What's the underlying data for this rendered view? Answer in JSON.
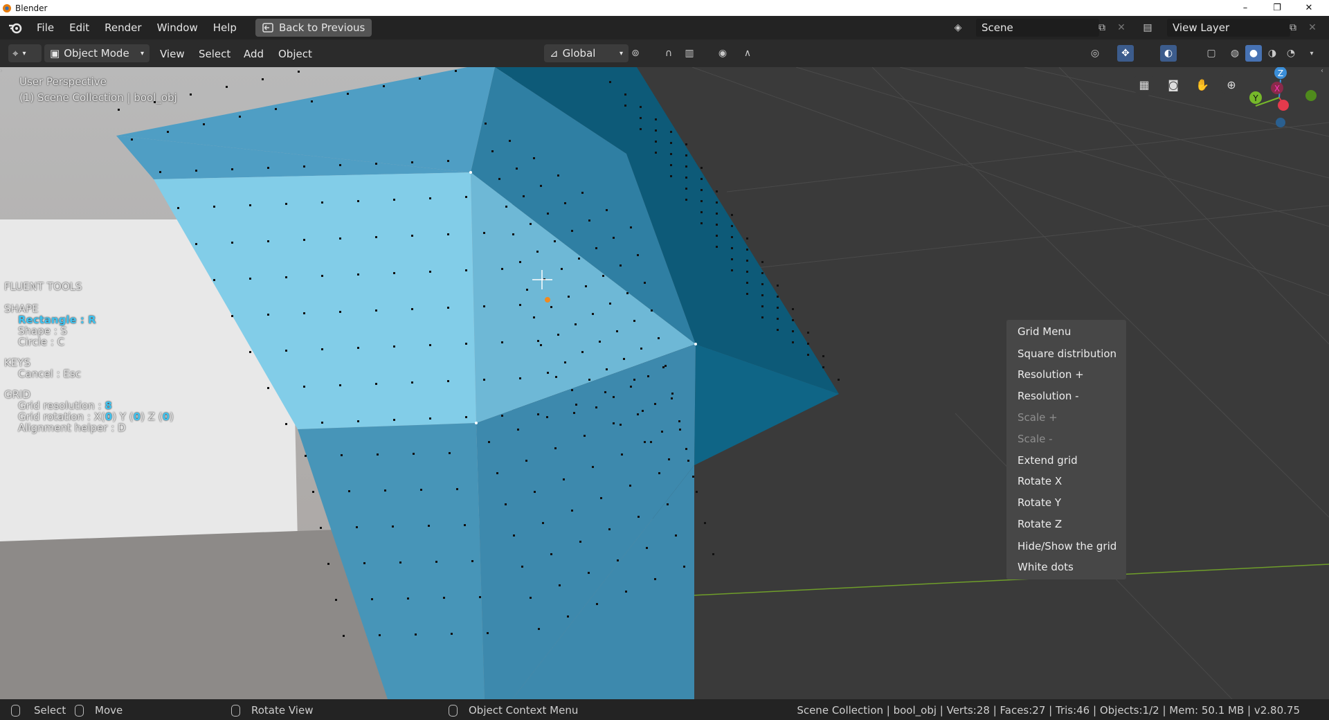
{
  "window": {
    "title": "Blender",
    "controls": [
      "–",
      "❐",
      "✕"
    ]
  },
  "menubar": {
    "items": [
      "File",
      "Edit",
      "Render",
      "Window",
      "Help"
    ],
    "back_button": "Back to Previous",
    "scene": "Scene",
    "view_layer": "View Layer"
  },
  "header": {
    "mode": "Object Mode",
    "menus": [
      "View",
      "Select",
      "Add",
      "Object"
    ],
    "orientation": "Global"
  },
  "viewport": {
    "perspective": "User Perspective",
    "collection": "(1) Scene Collection | bool_obj",
    "gizmo": {
      "z": "Z",
      "x": "X",
      "y": "Y"
    }
  },
  "fluent": {
    "title": "FLUENT TOOLS",
    "shape_header": "SHAPE",
    "rectangle": "Rectangle : R",
    "shape": "Shape : S",
    "circle": "Circle : C",
    "keys_header": "KEYS",
    "cancel": "Cancel : Esc",
    "grid_header": "GRID",
    "grid_resolution_label": "Grid resolution : ",
    "grid_resolution_value": "8",
    "grid_rotation_label": "Grid rotation : X(",
    "rot_x": "0",
    "rot_y_label": ") Y (",
    "rot_y": "0",
    "rot_z_label": ") Z (",
    "rot_z": "0",
    "rot_end": ")",
    "alignment": "Alignment helper : D"
  },
  "grid_menu": {
    "items": [
      {
        "label": "Grid Menu",
        "enabled": true
      },
      {
        "label": "Square distribution",
        "enabled": true
      },
      {
        "label": "Resolution +",
        "enabled": true
      },
      {
        "label": "Resolution -",
        "enabled": true
      },
      {
        "label": "Scale +",
        "enabled": false
      },
      {
        "label": "Scale -",
        "enabled": false
      },
      {
        "label": "Extend grid",
        "enabled": true
      },
      {
        "label": "Rotate X",
        "enabled": true
      },
      {
        "label": "Rotate Y",
        "enabled": true
      },
      {
        "label": "Rotate Z",
        "enabled": true
      },
      {
        "label": "Hide/Show the grid",
        "enabled": true
      },
      {
        "label": "White dots",
        "enabled": true
      }
    ]
  },
  "statusbar": {
    "select": "Select",
    "move": "Move",
    "rotate_view": "Rotate View",
    "context_menu": "Object Context Menu",
    "stats": "Scene Collection | bool_obj | Verts:28 | Faces:27 | Tris:46 | Objects:1/2 | Mem: 50.1 MB | v2.80.75"
  },
  "colors": {
    "accent": "#3fc3f0",
    "menu_bg": "#474747",
    "topbar_bg": "#232323",
    "viewport_bg": "#393939"
  }
}
